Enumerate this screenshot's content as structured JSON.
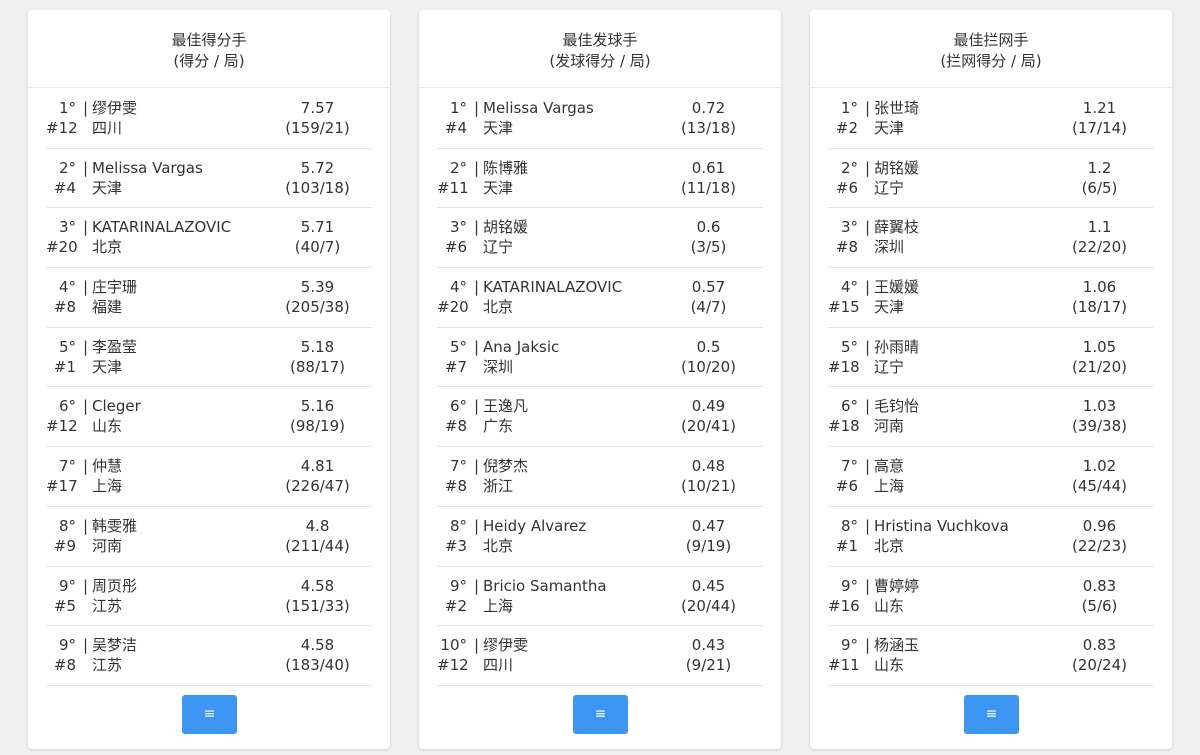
{
  "colors": {
    "button": "#3e96f4",
    "card": "#ffffff",
    "background": "#f0f0f0"
  },
  "icons": {
    "more": "menu-icon"
  },
  "cards": [
    {
      "title": "最佳得分手",
      "subtitle": "(得分 / 局)",
      "more_glyph": "≡",
      "rows": [
        {
          "rank": "1°",
          "num": "#12",
          "name": "缪伊雯",
          "team": "四川",
          "value": "7.57",
          "ratio": "(159/21)"
        },
        {
          "rank": "2°",
          "num": "#4",
          "name": "Melissa Vargas",
          "team": "天津",
          "value": "5.72",
          "ratio": "(103/18)"
        },
        {
          "rank": "3°",
          "num": "#20",
          "name": "KATARINALAZOVIC",
          "team": "北京",
          "value": "5.71",
          "ratio": "(40/7)"
        },
        {
          "rank": "4°",
          "num": "#8",
          "name": "庄宇珊",
          "team": "福建",
          "value": "5.39",
          "ratio": "(205/38)"
        },
        {
          "rank": "5°",
          "num": "#1",
          "name": "李盈莹",
          "team": "天津",
          "value": "5.18",
          "ratio": "(88/17)"
        },
        {
          "rank": "6°",
          "num": "#12",
          "name": "Cleger",
          "team": "山东",
          "value": "5.16",
          "ratio": "(98/19)"
        },
        {
          "rank": "7°",
          "num": "#17",
          "name": "仲慧",
          "team": "上海",
          "value": "4.81",
          "ratio": "(226/47)"
        },
        {
          "rank": "8°",
          "num": "#9",
          "name": "韩雯雅",
          "team": "河南",
          "value": "4.8",
          "ratio": "(211/44)"
        },
        {
          "rank": "9°",
          "num": "#5",
          "name": "周页彤",
          "team": "江苏",
          "value": "4.58",
          "ratio": "(151/33)"
        },
        {
          "rank": "9°",
          "num": "#8",
          "name": "吴梦洁",
          "team": "江苏",
          "value": "4.58",
          "ratio": "(183/40)"
        }
      ]
    },
    {
      "title": "最佳发球手",
      "subtitle": "(发球得分 / 局)",
      "more_glyph": "≡",
      "rows": [
        {
          "rank": "1°",
          "num": "#4",
          "name": "Melissa Vargas",
          "team": "天津",
          "value": "0.72",
          "ratio": "(13/18)"
        },
        {
          "rank": "2°",
          "num": "#11",
          "name": "陈博雅",
          "team": "天津",
          "value": "0.61",
          "ratio": "(11/18)"
        },
        {
          "rank": "3°",
          "num": "#6",
          "name": "胡铭媛",
          "team": "辽宁",
          "value": "0.6",
          "ratio": "(3/5)"
        },
        {
          "rank": "4°",
          "num": "#20",
          "name": "KATARINALAZOVIC",
          "team": "北京",
          "value": "0.57",
          "ratio": "(4/7)"
        },
        {
          "rank": "5°",
          "num": "#7",
          "name": "Ana Jaksic",
          "team": "深圳",
          "value": "0.5",
          "ratio": "(10/20)"
        },
        {
          "rank": "6°",
          "num": "#8",
          "name": "王逸凡",
          "team": "广东",
          "value": "0.49",
          "ratio": "(20/41)"
        },
        {
          "rank": "7°",
          "num": "#8",
          "name": "倪梦杰",
          "team": "浙江",
          "value": "0.48",
          "ratio": "(10/21)"
        },
        {
          "rank": "8°",
          "num": "#3",
          "name": "Heidy Alvarez",
          "team": "北京",
          "value": "0.47",
          "ratio": "(9/19)"
        },
        {
          "rank": "9°",
          "num": "#2",
          "name": "Bricio Samantha",
          "team": "上海",
          "value": "0.45",
          "ratio": "(20/44)"
        },
        {
          "rank": "10°",
          "num": "#12",
          "name": "缪伊雯",
          "team": "四川",
          "value": "0.43",
          "ratio": "(9/21)"
        }
      ]
    },
    {
      "title": "最佳拦网手",
      "subtitle": "(拦网得分 / 局)",
      "more_glyph": "≡",
      "rows": [
        {
          "rank": "1°",
          "num": "#2",
          "name": "张世琦",
          "team": "天津",
          "value": "1.21",
          "ratio": "(17/14)"
        },
        {
          "rank": "2°",
          "num": "#6",
          "name": "胡铭媛",
          "team": "辽宁",
          "value": "1.2",
          "ratio": "(6/5)"
        },
        {
          "rank": "3°",
          "num": "#8",
          "name": "薛翼枝",
          "team": "深圳",
          "value": "1.1",
          "ratio": "(22/20)"
        },
        {
          "rank": "4°",
          "num": "#15",
          "name": "王媛媛",
          "team": "天津",
          "value": "1.06",
          "ratio": "(18/17)"
        },
        {
          "rank": "5°",
          "num": "#18",
          "name": "孙雨晴",
          "team": "辽宁",
          "value": "1.05",
          "ratio": "(21/20)"
        },
        {
          "rank": "6°",
          "num": "#18",
          "name": "毛钧怡",
          "team": "河南",
          "value": "1.03",
          "ratio": "(39/38)"
        },
        {
          "rank": "7°",
          "num": "#6",
          "name": "高意",
          "team": "上海",
          "value": "1.02",
          "ratio": "(45/44)"
        },
        {
          "rank": "8°",
          "num": "#1",
          "name": "Hristina Vuchkova",
          "team": "北京",
          "value": "0.96",
          "ratio": "(22/23)"
        },
        {
          "rank": "9°",
          "num": "#16",
          "name": "曹婷婷",
          "team": "山东",
          "value": "0.83",
          "ratio": "(5/6)"
        },
        {
          "rank": "9°",
          "num": "#11",
          "name": "杨涵玉",
          "team": "山东",
          "value": "0.83",
          "ratio": "(20/24)"
        }
      ]
    }
  ]
}
